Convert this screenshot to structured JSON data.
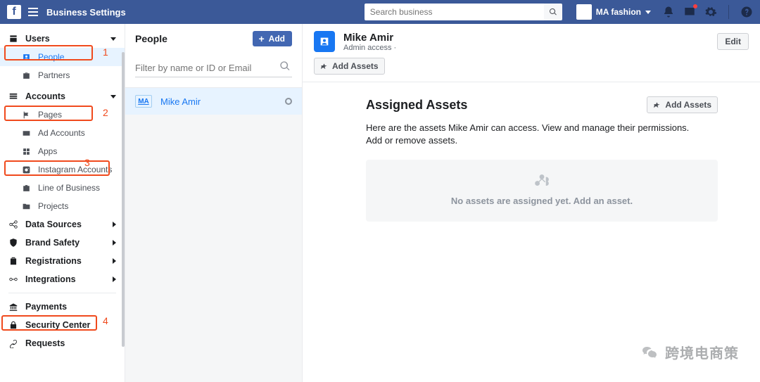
{
  "topbar": {
    "title": "Business Settings",
    "search_placeholder": "Search business",
    "business_name": "MA fashion"
  },
  "sidebar": {
    "users": {
      "label": "Users",
      "items": [
        "People",
        "Partners"
      ]
    },
    "accounts": {
      "label": "Accounts",
      "items": [
        "Pages",
        "Ad Accounts",
        "Apps",
        "Instagram Accounts",
        "Line of Business",
        "Projects"
      ]
    },
    "data_sources": "Data Sources",
    "brand_safety": "Brand Safety",
    "registrations": "Registrations",
    "integrations": "Integrations",
    "payments": "Payments",
    "security_center": "Security Center",
    "requests": "Requests"
  },
  "annotations": {
    "n1": "1",
    "n2": "2",
    "n3": "3",
    "n4": "4"
  },
  "people_col": {
    "heading": "People",
    "add_label": "Add",
    "filter_placeholder": "Filter by name or ID or Email",
    "person_initials": "MA",
    "person_name": "Mike Amir"
  },
  "detail": {
    "name": "Mike Amir",
    "role": "Admin access ·",
    "edit_label": "Edit",
    "add_assets_label": "Add Assets",
    "assigned_heading": "Assigned Assets",
    "add_assets_label2": "Add Assets",
    "assigned_desc": "Here are the assets Mike Amir can access. View and manage their permissions. Add or remove assets.",
    "empty_msg": "No assets are assigned yet. Add an asset."
  },
  "watermark": "跨境电商策"
}
